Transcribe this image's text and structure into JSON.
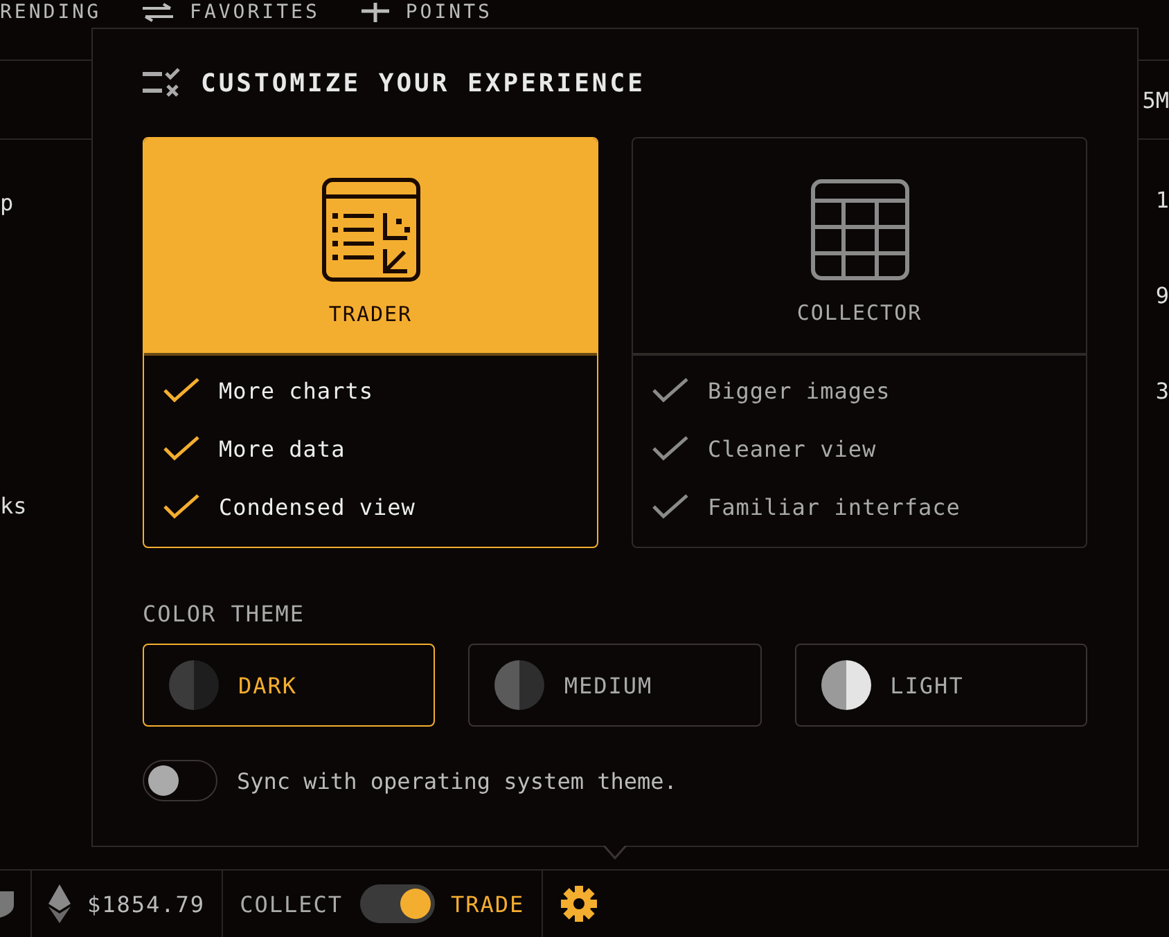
{
  "background": {
    "nav_tabs": [
      "RENDING",
      "FAVORITES",
      "POINTS"
    ],
    "left_fragments": [
      "p",
      "ks"
    ],
    "right_fragments": [
      "5M",
      "1",
      "9",
      "3"
    ]
  },
  "popover": {
    "title": "CUSTOMIZE YOUR EXPERIENCE",
    "modes": [
      {
        "label": "TRADER",
        "kind": "trader",
        "selected": true,
        "features": [
          "More charts",
          "More data",
          "Condensed view"
        ]
      },
      {
        "label": "COLLECTOR",
        "kind": "collector",
        "selected": false,
        "features": [
          "Bigger images",
          "Cleaner view",
          "Familiar interface"
        ]
      }
    ],
    "theme_heading": "COLOR THEME",
    "themes": [
      {
        "label": "DARK",
        "kind": "dark",
        "selected": true
      },
      {
        "label": "MEDIUM",
        "kind": "medium",
        "selected": false
      },
      {
        "label": "LIGHT",
        "kind": "light",
        "selected": false
      }
    ],
    "sync": {
      "label": "Sync with operating system theme.",
      "on": false
    }
  },
  "status_bar": {
    "eth_price": "$1854.79",
    "collect_label": "COLLECT",
    "trade_label": "TRADE",
    "mode_toggle": {
      "on": true
    }
  }
}
